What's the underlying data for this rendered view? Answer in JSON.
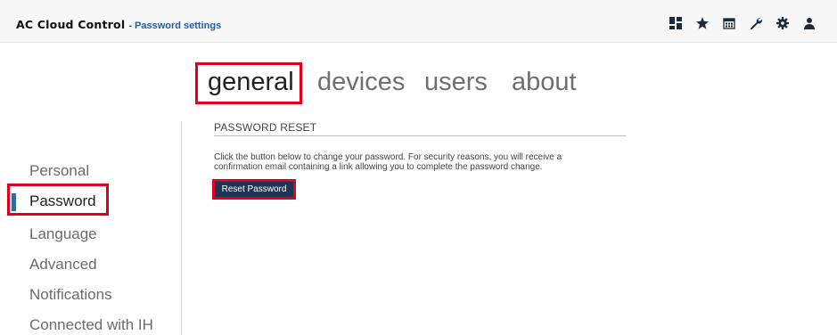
{
  "header": {
    "app_name": "AC Cloud Control",
    "separator": "-",
    "page_name": "Password settings",
    "icons": [
      "dashboard-icon",
      "star-icon",
      "calendar-icon",
      "wrench-icon",
      "gear-icon",
      "user-icon"
    ]
  },
  "tabs": [
    {
      "label": "general",
      "active": true
    },
    {
      "label": "devices",
      "active": false
    },
    {
      "label": "users",
      "active": false
    },
    {
      "label": "about",
      "active": false
    }
  ],
  "sidebar": {
    "items": [
      {
        "label": "Personal",
        "active": false
      },
      {
        "label": "Password",
        "active": true
      },
      {
        "label": "Language",
        "active": false
      },
      {
        "label": "Advanced",
        "active": false
      },
      {
        "label": "Notifications",
        "active": false
      },
      {
        "label": "Connected with IH",
        "active": false
      }
    ]
  },
  "main": {
    "section_title": "PASSWORD RESET",
    "description_line1": "Click the button below to change your password. For security reasons, you will receive a",
    "description_line2": "confirmation email containing a link allowing you to complete the password change.",
    "reset_button_label": "Reset Password"
  },
  "colors": {
    "accent": "#1f5fa8",
    "button_bg": "#1c3557",
    "highlight": "#e0001b",
    "active_marker": "#1f6ec0"
  }
}
